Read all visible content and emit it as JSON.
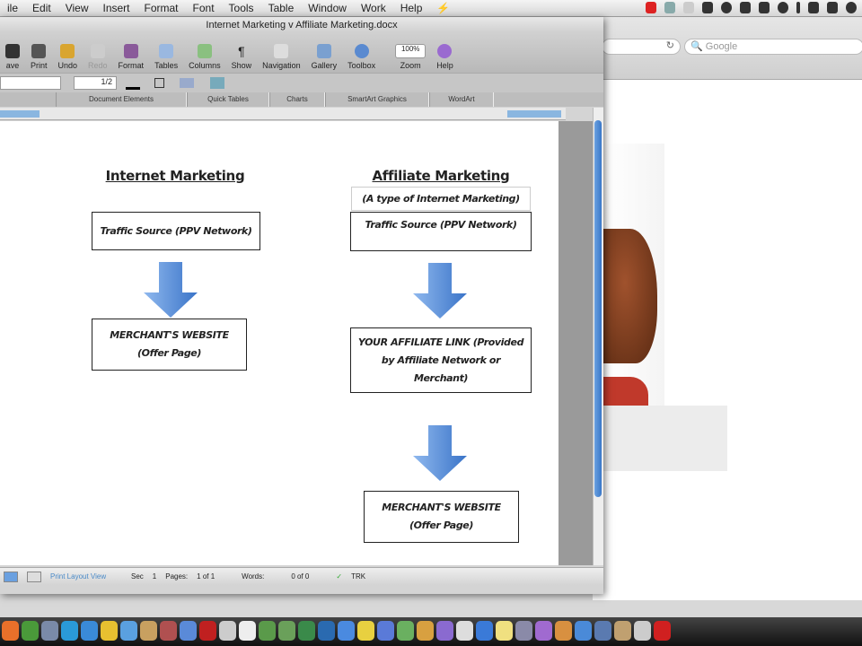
{
  "menubar": {
    "items": [
      "ile",
      "Edit",
      "View",
      "Insert",
      "Format",
      "Font",
      "Tools",
      "Table",
      "Window",
      "Work",
      "Help"
    ]
  },
  "browser": {
    "search_placeholder": "Google",
    "reload": "↻"
  },
  "word": {
    "title": "Internet Marketing v Affiliate Marketing.docx",
    "toolbar": [
      "ave",
      "Print",
      "Undo",
      "Redo",
      "Format",
      "Tables",
      "Columns",
      "Show",
      "Navigation",
      "Gallery",
      "Toolbox",
      "Zoom",
      "Help"
    ],
    "zoom_value": "100%",
    "spacing_value": "1/2",
    "ribbon_tabs": [
      "Document Elements",
      "Quick Tables",
      "Charts",
      "SmartArt Graphics",
      "WordArt"
    ],
    "status": {
      "view": "Print Layout View",
      "sec_label": "Sec",
      "sec": "1",
      "pages_label": "Pages:",
      "pages": "1 of 1",
      "words_label": "Words:",
      "words": "0 of 0",
      "trk": "TRK"
    }
  },
  "document": {
    "left": {
      "title": "Internet Marketing",
      "box1": "Traffic Source (PPV Network)",
      "box2": "MERCHANT'S WEBSITE (Offer Page)"
    },
    "right": {
      "title": "Affiliate Marketing",
      "subtitle": "(A type of Internet Marketing)",
      "box1": "Traffic Source (PPV Network)",
      "box2": "YOUR AFFILIATE LINK (Provided by Affiliate Network or Merchant)",
      "box3": "MERCHANT'S WEBSITE (Offer Page)"
    },
    "arrow_color": "#4a86d8"
  }
}
